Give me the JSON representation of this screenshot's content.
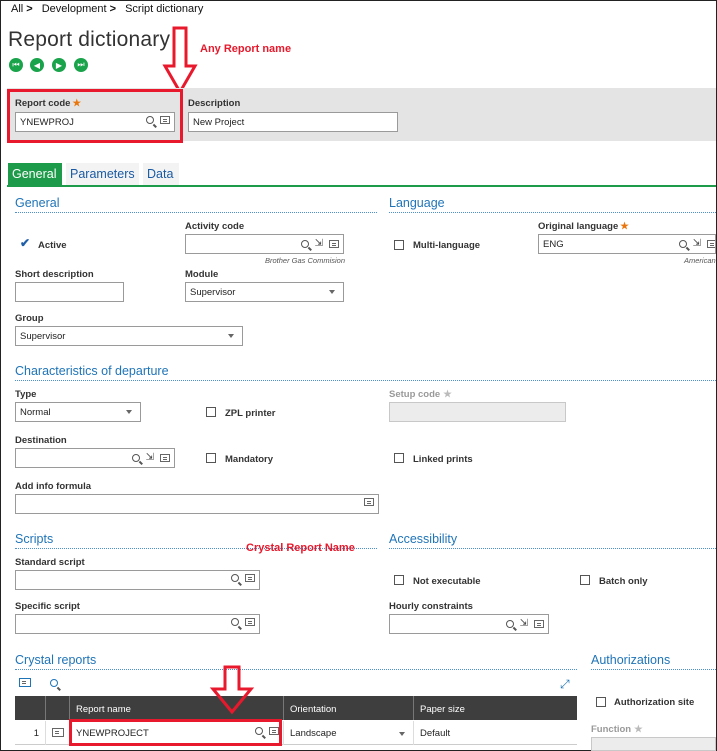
{
  "breadcrumb": {
    "items": [
      "All",
      "Development",
      "Script dictionary"
    ],
    "separator": ">"
  },
  "page": {
    "title": "Report dictionary"
  },
  "annotations": {
    "report_name": "Any Report name",
    "crystal_report_name": "Crystal Report Name"
  },
  "header": {
    "report_code": {
      "label": "Report code",
      "value": "YNEWPROJ",
      "required": "★"
    },
    "description": {
      "label": "Description",
      "value": "New Project"
    }
  },
  "tabs": [
    "General",
    "Parameters",
    "Data"
  ],
  "general": {
    "title": "General",
    "active_label": "Active",
    "active_checked": true,
    "activity_code": {
      "label": "Activity code",
      "value": "",
      "subtext": "Brother Gas Commision"
    },
    "short_description": {
      "label": "Short description",
      "value": ""
    },
    "module": {
      "label": "Module",
      "value": "Supervisor"
    },
    "group": {
      "label": "Group",
      "value": "Supervisor"
    }
  },
  "language": {
    "title": "Language",
    "multi_language_label": "Multi-language",
    "original_language": {
      "label": "Original language",
      "value": "ENG",
      "required": "★",
      "subtext": "American"
    }
  },
  "departure": {
    "title": "Characteristics of departure",
    "type": {
      "label": "Type",
      "value": "Normal"
    },
    "zpl_printer_label": "ZPL printer",
    "setup_code": {
      "label": "Setup code",
      "star": "★",
      "value": ""
    },
    "destination": {
      "label": "Destination",
      "value": ""
    },
    "mandatory_label": "Mandatory",
    "linked_prints_label": "Linked prints",
    "add_info_formula": {
      "label": "Add info formula",
      "value": ""
    }
  },
  "scripts": {
    "title": "Scripts",
    "standard_script": {
      "label": "Standard script",
      "value": ""
    },
    "specific_script": {
      "label": "Specific script",
      "value": ""
    }
  },
  "accessibility": {
    "title": "Accessibility",
    "not_executable_label": "Not executable",
    "batch_only_label": "Batch only",
    "hourly_constraints": {
      "label": "Hourly constraints",
      "value": ""
    }
  },
  "crystal_reports": {
    "title": "Crystal reports",
    "columns": [
      "Report name",
      "Orientation",
      "Paper size"
    ],
    "rows": [
      {
        "index": "1",
        "report_name": "YNEWPROJECT",
        "orientation": "Landscape",
        "paper_size": "Default"
      }
    ]
  },
  "authorizations": {
    "title": "Authorizations",
    "authorization_site_label": "Authorization site",
    "function": {
      "label": "Function",
      "star": "★"
    }
  },
  "colors": {
    "accent_green": "#1e9b4a",
    "link_blue": "#1f74b8",
    "annotation_red": "#e8192c",
    "required_orange": "#e8760c"
  }
}
